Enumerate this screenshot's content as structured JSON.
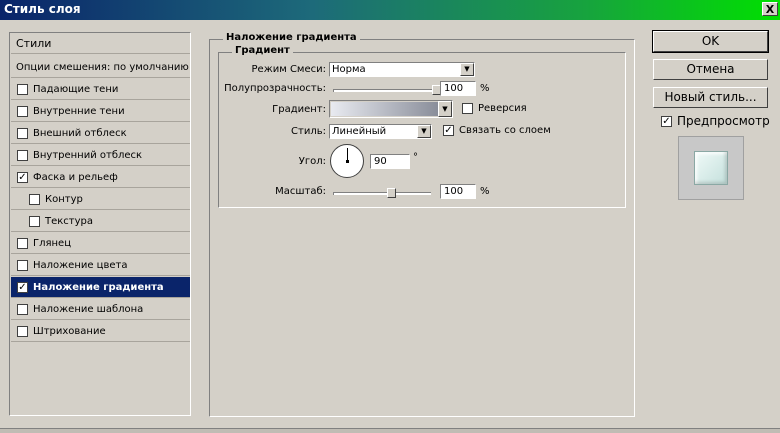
{
  "window": {
    "title": "Стиль слоя",
    "close": "X"
  },
  "style_list": {
    "header": "Стили",
    "blend_options": "Опции смешения: по умолчанию",
    "items": [
      {
        "label": "Падающие тени",
        "checked": false,
        "indent": false,
        "selected": false,
        "name": "drop-shadow"
      },
      {
        "label": "Внутренние тени",
        "checked": false,
        "indent": false,
        "selected": false,
        "name": "inner-shadow"
      },
      {
        "label": "Внешний отблеск",
        "checked": false,
        "indent": false,
        "selected": false,
        "name": "outer-glow"
      },
      {
        "label": "Внутренний отблеск",
        "checked": false,
        "indent": false,
        "selected": false,
        "name": "inner-glow"
      },
      {
        "label": "Фаска и рельеф",
        "checked": true,
        "indent": false,
        "selected": false,
        "name": "bevel-emboss"
      },
      {
        "label": "Контур",
        "checked": false,
        "indent": true,
        "selected": false,
        "name": "contour"
      },
      {
        "label": "Текстура",
        "checked": false,
        "indent": true,
        "selected": false,
        "name": "texture"
      },
      {
        "label": "Глянец",
        "checked": false,
        "indent": false,
        "selected": false,
        "name": "satin"
      },
      {
        "label": "Наложение цвета",
        "checked": false,
        "indent": false,
        "selected": false,
        "name": "color-overlay"
      },
      {
        "label": "Наложение градиента",
        "checked": true,
        "indent": false,
        "selected": true,
        "name": "gradient-overlay"
      },
      {
        "label": "Наложение шаблона",
        "checked": false,
        "indent": false,
        "selected": false,
        "name": "pattern-overlay"
      },
      {
        "label": "Штрихование",
        "checked": false,
        "indent": false,
        "selected": false,
        "name": "stroke"
      }
    ]
  },
  "panel": {
    "title": "Наложение градиента",
    "group_title": "Градиент",
    "blend_mode": {
      "label": "Режим Смеси:",
      "value": "Норма"
    },
    "opacity": {
      "label": "Полупрозрачность:",
      "value": "100",
      "unit": "%",
      "level": 1.0
    },
    "gradient": {
      "label": "Градиент:",
      "reverse_label": "Реверсия",
      "reverse_checked": false
    },
    "style": {
      "label": "Стиль:",
      "value": "Линейный",
      "align_label": "Связать со слоем",
      "align_checked": true
    },
    "angle": {
      "label": "Угол:",
      "value": "90",
      "unit": "°"
    },
    "scale": {
      "label": "Масштаб:",
      "value": "100",
      "unit": "%",
      "level": 0.6
    }
  },
  "buttons": {
    "ok": "OK",
    "cancel": "Отмена",
    "new_style": "Новый стиль...",
    "preview_label": "Предпросмотр",
    "preview_checked": true
  },
  "check_glyph": "✓"
}
